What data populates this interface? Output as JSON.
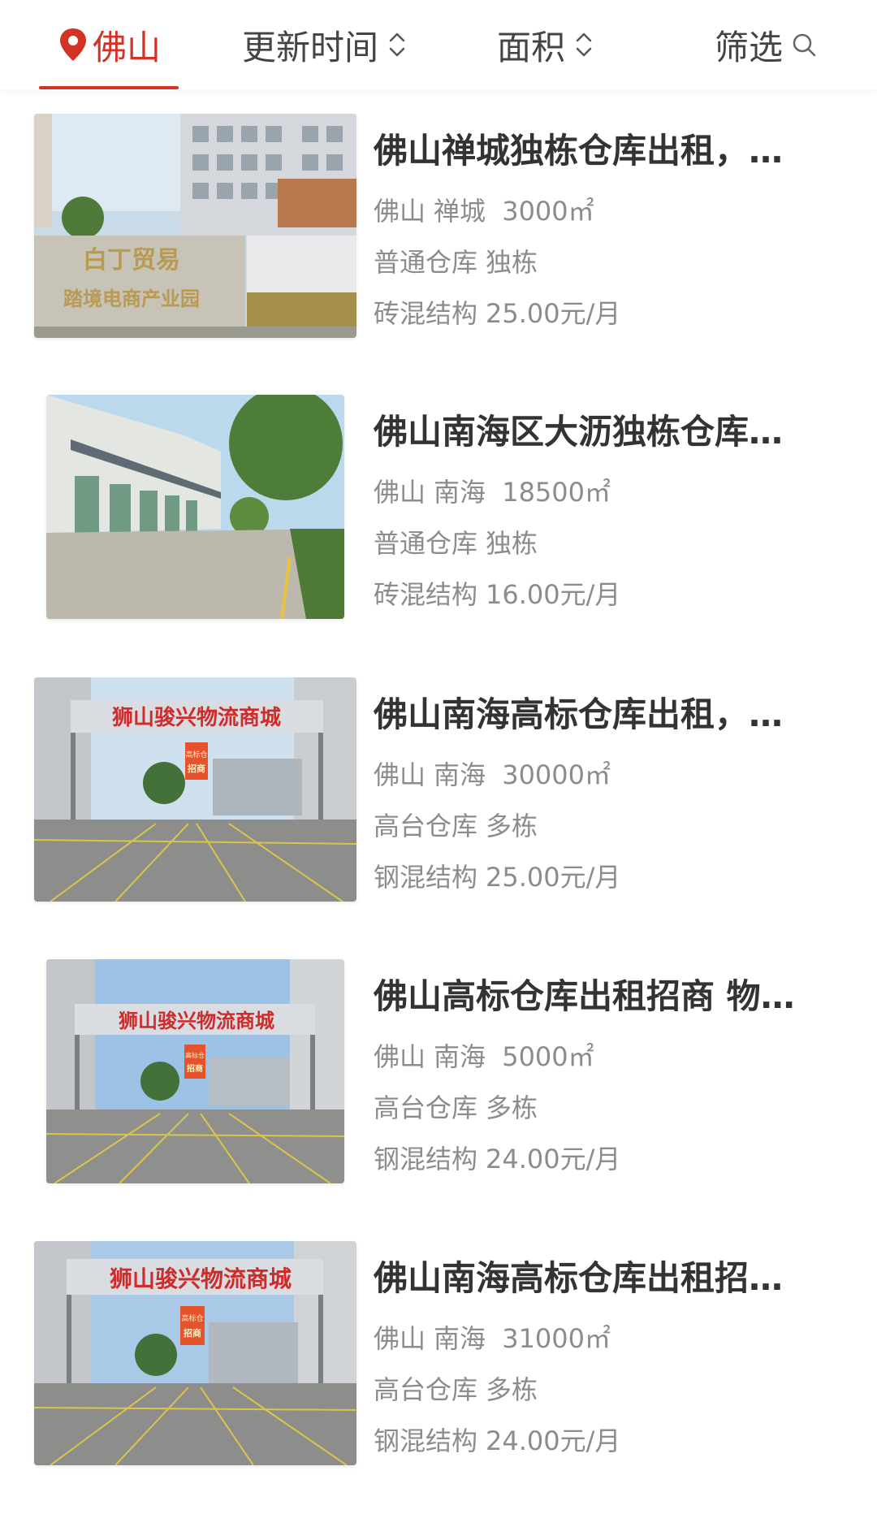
{
  "filter_bar": {
    "city": "佛山",
    "update_time": "更新时间",
    "area": "面积",
    "filter": "筛选"
  },
  "colors": {
    "accent": "#d23325"
  },
  "listings": [
    {
      "title": "佛山禅城独栋仓库出租，…",
      "city": "佛山",
      "district": "禅城",
      "size": "3000㎡",
      "type": "普通仓库",
      "building": "独栋",
      "structure": "砖混结构",
      "price": "25.00元/月",
      "photo": {
        "sign_line1": "白丁贸易",
        "sign_line2": "踏境电商产业园"
      }
    },
    {
      "title": "佛山南海区大沥独栋仓库…",
      "city": "佛山",
      "district": "南海",
      "size": "18500㎡",
      "type": "普通仓库",
      "building": "独栋",
      "structure": "砖混结构",
      "price": "16.00元/月"
    },
    {
      "title": "佛山南海高标仓库出租，…",
      "city": "佛山",
      "district": "南海",
      "size": "30000㎡",
      "type": "高台仓库",
      "building": "多栋",
      "structure": "钢混结构",
      "price": "25.00元/月",
      "photo": {
        "gate_sign": "狮山骏兴物流商城",
        "banner_line1": "高标仓",
        "banner_line2": "招商"
      }
    },
    {
      "title": "佛山高标仓库出租招商 物…",
      "city": "佛山",
      "district": "南海",
      "size": "5000㎡",
      "type": "高台仓库",
      "building": "多栋",
      "structure": "钢混结构",
      "price": "24.00元/月",
      "photo": {
        "gate_sign": "狮山骏兴物流商城",
        "banner_line1": "高标仓",
        "banner_line2": "招商"
      }
    },
    {
      "title": "佛山南海高标仓库出租招…",
      "city": "佛山",
      "district": "南海",
      "size": "31000㎡",
      "type": "高台仓库",
      "building": "多栋",
      "structure": "钢混结构",
      "price": "24.00元/月",
      "photo": {
        "gate_sign": "狮山骏兴物流商城",
        "banner_line1": "高标仓",
        "banner_line2": "招商"
      }
    }
  ]
}
